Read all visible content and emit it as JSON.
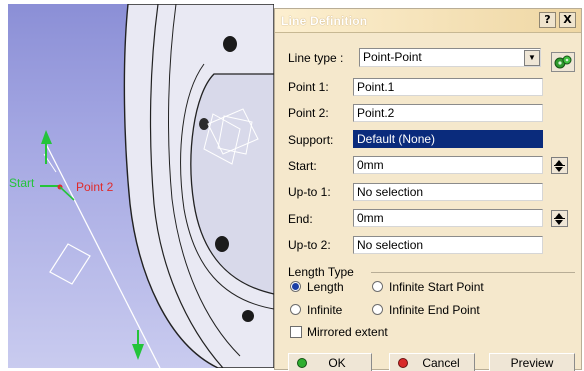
{
  "viewport": {
    "start_label": "Start",
    "point_label": "Point 2"
  },
  "dialog": {
    "title": "Line Definition",
    "help_glyph": "?",
    "close_glyph": "X",
    "line_type": {
      "label": "Line type :",
      "value": "Point-Point"
    },
    "point1": {
      "label": "Point 1:",
      "value": "Point.1"
    },
    "point2": {
      "label": "Point 2:",
      "value": "Point.2"
    },
    "support": {
      "label": "Support:",
      "value": "Default (None)"
    },
    "start": {
      "label": "Start:",
      "value": "0mm"
    },
    "upto1": {
      "label": "Up-to 1:",
      "value": "No selection"
    },
    "end": {
      "label": "End:",
      "value": "0mm"
    },
    "upto2": {
      "label": "Up-to 2:",
      "value": "No selection"
    },
    "length_type": {
      "title": "Length Type",
      "options": [
        "Length",
        "Infinite Start Point",
        "Infinite",
        "Infinite End Point"
      ],
      "selected": "Length"
    },
    "mirrored_extent": {
      "label": "Mirrored extent",
      "checked": false
    },
    "buttons": {
      "ok": "OK",
      "cancel": "Cancel",
      "preview": "Preview"
    }
  },
  "colors": {
    "dialog_bg": "#f5e8cc",
    "selected_field": "#0a2b7c",
    "ok_icon": "#2fae2f",
    "cancel_icon": "#d92a2a",
    "start_label": "#24c43a",
    "point_label": "#e02a2a"
  },
  "icons": {
    "line_type_action": "gears-icon",
    "ok": "green-dot-icon",
    "cancel": "red-dot-icon"
  }
}
